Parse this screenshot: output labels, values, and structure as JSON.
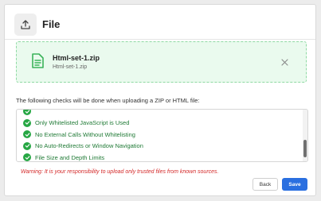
{
  "dialog": {
    "title": "File",
    "header_icon": "upload-icon"
  },
  "file": {
    "name": "Html-set-1.zip",
    "subname": "Html-set-1.zip",
    "icon": "document-icon",
    "remove_icon": "close-icon"
  },
  "checks": {
    "intro": "The following checks will be done when uploading a ZIP or HTML file:",
    "items": [
      {
        "label": ""
      },
      {
        "label": "Only Whitelisted JavaScript is Used"
      },
      {
        "label": "No External Calls Without Whitelisting"
      },
      {
        "label": "No Auto-Redirects or Window Navigation"
      },
      {
        "label": "File Size and Depth Limits"
      }
    ],
    "icon": "check-circle-icon"
  },
  "warning": "Warning: It is your responsibility to upload only trusted files from known sources.",
  "buttons": {
    "back": "Back",
    "save": "Save"
  },
  "colors": {
    "accent": "#2a6fe0",
    "success": "#27a744",
    "warning": "#d42a2a",
    "file_bg": "#eafaee"
  }
}
